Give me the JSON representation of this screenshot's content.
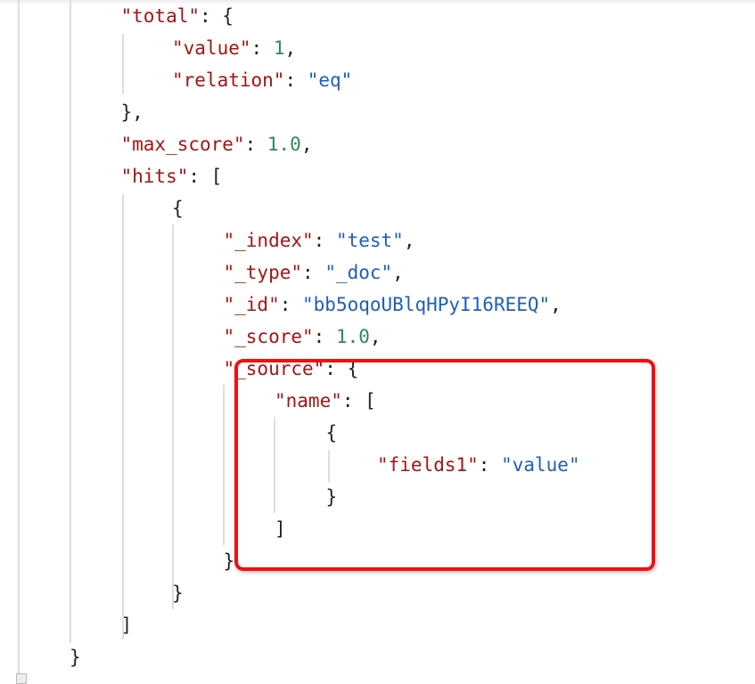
{
  "colors": {
    "key": "#a31515",
    "number": "#2e8b57",
    "string": "#1f5fb8",
    "highlight": "#f01010"
  },
  "lines": [
    {
      "level": 1,
      "key": "\"total\"",
      "punct": ": {"
    },
    {
      "level": 2,
      "key": "\"value\"",
      "punct": ": ",
      "num": "1",
      "tail": ","
    },
    {
      "level": 2,
      "key": "\"relation\"",
      "punct": ": ",
      "str": "\"eq\""
    },
    {
      "level": 1,
      "punct": "},"
    },
    {
      "level": 1,
      "key": "\"max_score\"",
      "punct": ": ",
      "num": "1.0",
      "tail": ","
    },
    {
      "level": 1,
      "key": "\"hits\"",
      "punct": ": ["
    },
    {
      "level": 2,
      "punct": "{"
    },
    {
      "level": 3,
      "key": "\"_index\"",
      "punct": ": ",
      "str": "\"test\"",
      "tail": ","
    },
    {
      "level": 3,
      "key": "\"_type\"",
      "punct": ": ",
      "str": "\"_doc\"",
      "tail": ","
    },
    {
      "level": 3,
      "key": "\"_id\"",
      "punct": ": ",
      "str": "\"bb5oqoUBlqHPyI16REEQ\"",
      "tail": ","
    },
    {
      "level": 3,
      "key": "\"_score\"",
      "punct": ": ",
      "num": "1.0",
      "tail": ","
    },
    {
      "level": 3,
      "key": "\"_source\"",
      "punct": ": {"
    },
    {
      "level": 4,
      "key": "\"name\"",
      "punct": ": ["
    },
    {
      "level": 5,
      "punct": "{"
    },
    {
      "level": 6,
      "key": "\"fields1\"",
      "punct": ": ",
      "str": "\"value\""
    },
    {
      "level": 5,
      "punct": "}"
    },
    {
      "level": 4,
      "punct": "]"
    },
    {
      "level": 3,
      "punct": "}"
    },
    {
      "level": 2,
      "punct": "}"
    },
    {
      "level": 1,
      "punct": "]"
    },
    {
      "level": 0,
      "punct": "}"
    }
  ]
}
